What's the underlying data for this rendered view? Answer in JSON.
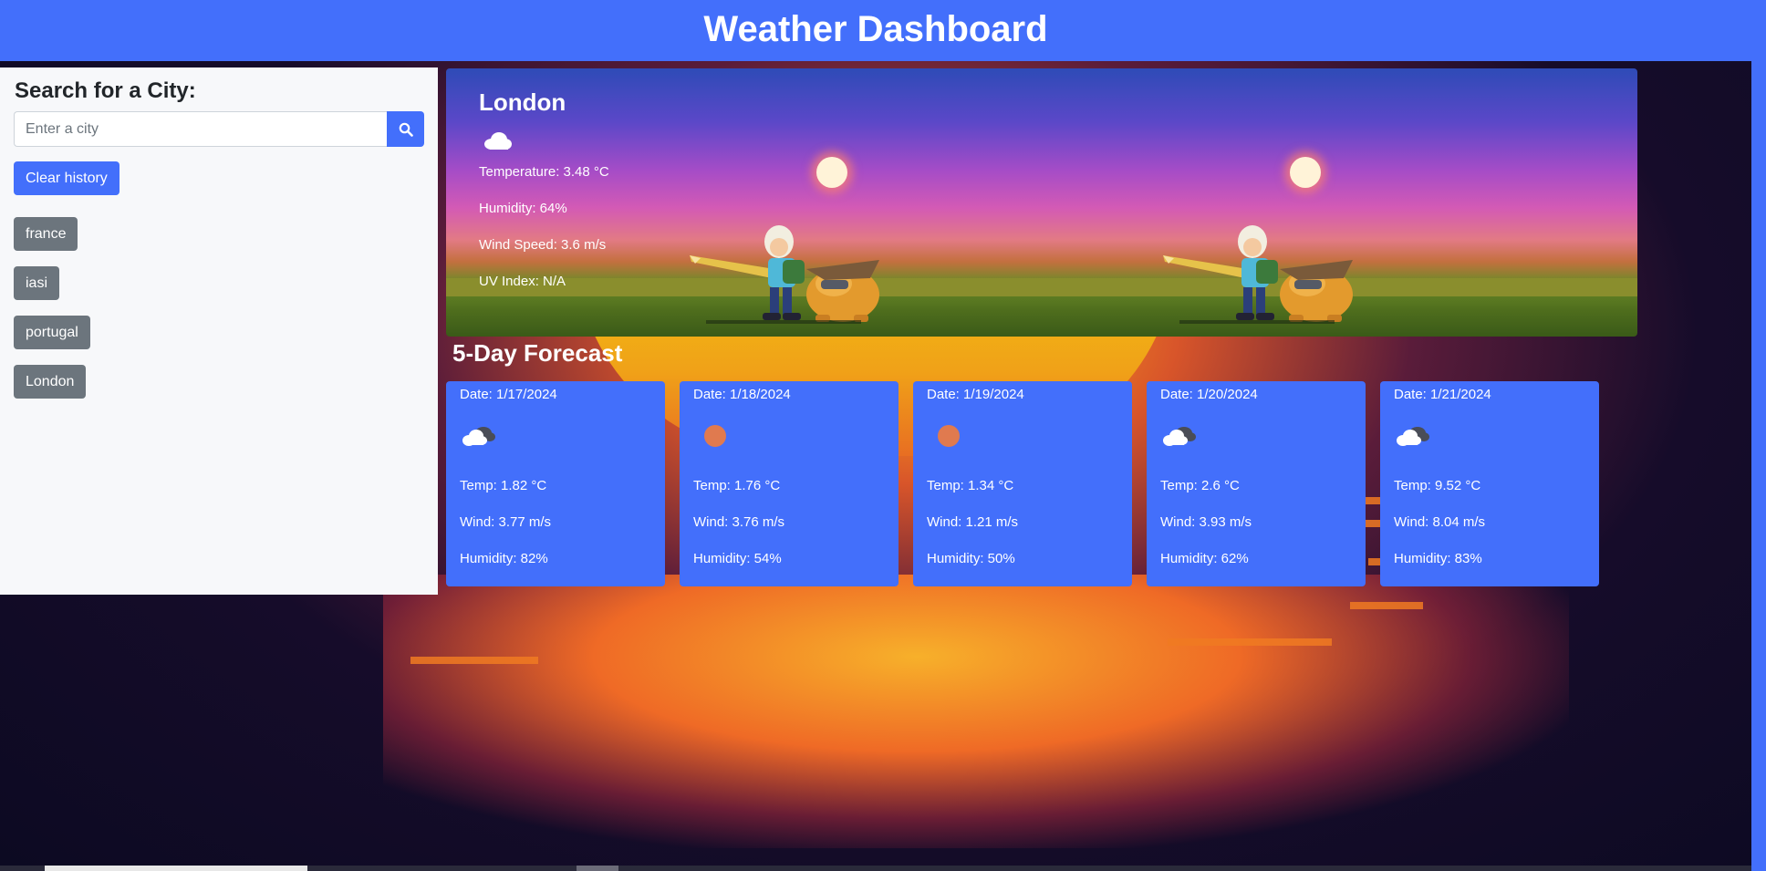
{
  "header": {
    "title": "Weather Dashboard"
  },
  "sidebar": {
    "heading": "Search for a City:",
    "search_placeholder": "Enter a city",
    "search_value": "",
    "search_icon": "search-icon",
    "clear_label": "Clear history",
    "history": [
      {
        "label": "france"
      },
      {
        "label": "iasi"
      },
      {
        "label": "portugal"
      },
      {
        "label": "London"
      }
    ]
  },
  "current": {
    "city": "London",
    "icon": "cloud-icon",
    "temperature": "Temperature: 3.48 °C",
    "humidity": "Humidity: 64%",
    "wind": "Wind Speed: 3.6 m/s",
    "uv": "UV Index: N/A"
  },
  "forecast": {
    "title": "5-Day Forecast",
    "days": [
      {
        "date": "Date: 1/17/2024",
        "icon": "broken-clouds-icon",
        "temp": "Temp: 1.82 °C",
        "wind": "Wind: 3.77 m/s",
        "humidity": "Humidity: 82%"
      },
      {
        "date": "Date: 1/18/2024",
        "icon": "clear-sun-icon",
        "temp": "Temp: 1.76 °C",
        "wind": "Wind: 3.76 m/s",
        "humidity": "Humidity: 54%"
      },
      {
        "date": "Date: 1/19/2024",
        "icon": "clear-sun-icon",
        "temp": "Temp: 1.34 °C",
        "wind": "Wind: 1.21 m/s",
        "humidity": "Humidity: 50%"
      },
      {
        "date": "Date: 1/20/2024",
        "icon": "broken-clouds-icon",
        "temp": "Temp: 2.6 °C",
        "wind": "Wind: 3.93 m/s",
        "humidity": "Humidity: 62%"
      },
      {
        "date": "Date: 1/21/2024",
        "icon": "broken-clouds-icon",
        "temp": "Temp: 9.52 °C",
        "wind": "Wind: 8.04 m/s",
        "humidity": "Humidity: 83%"
      }
    ]
  },
  "colors": {
    "primary": "#436ffb",
    "secondary": "#6c757d",
    "sidebar_bg": "#f7f8fa",
    "sun_icon": "#e07a4f"
  }
}
